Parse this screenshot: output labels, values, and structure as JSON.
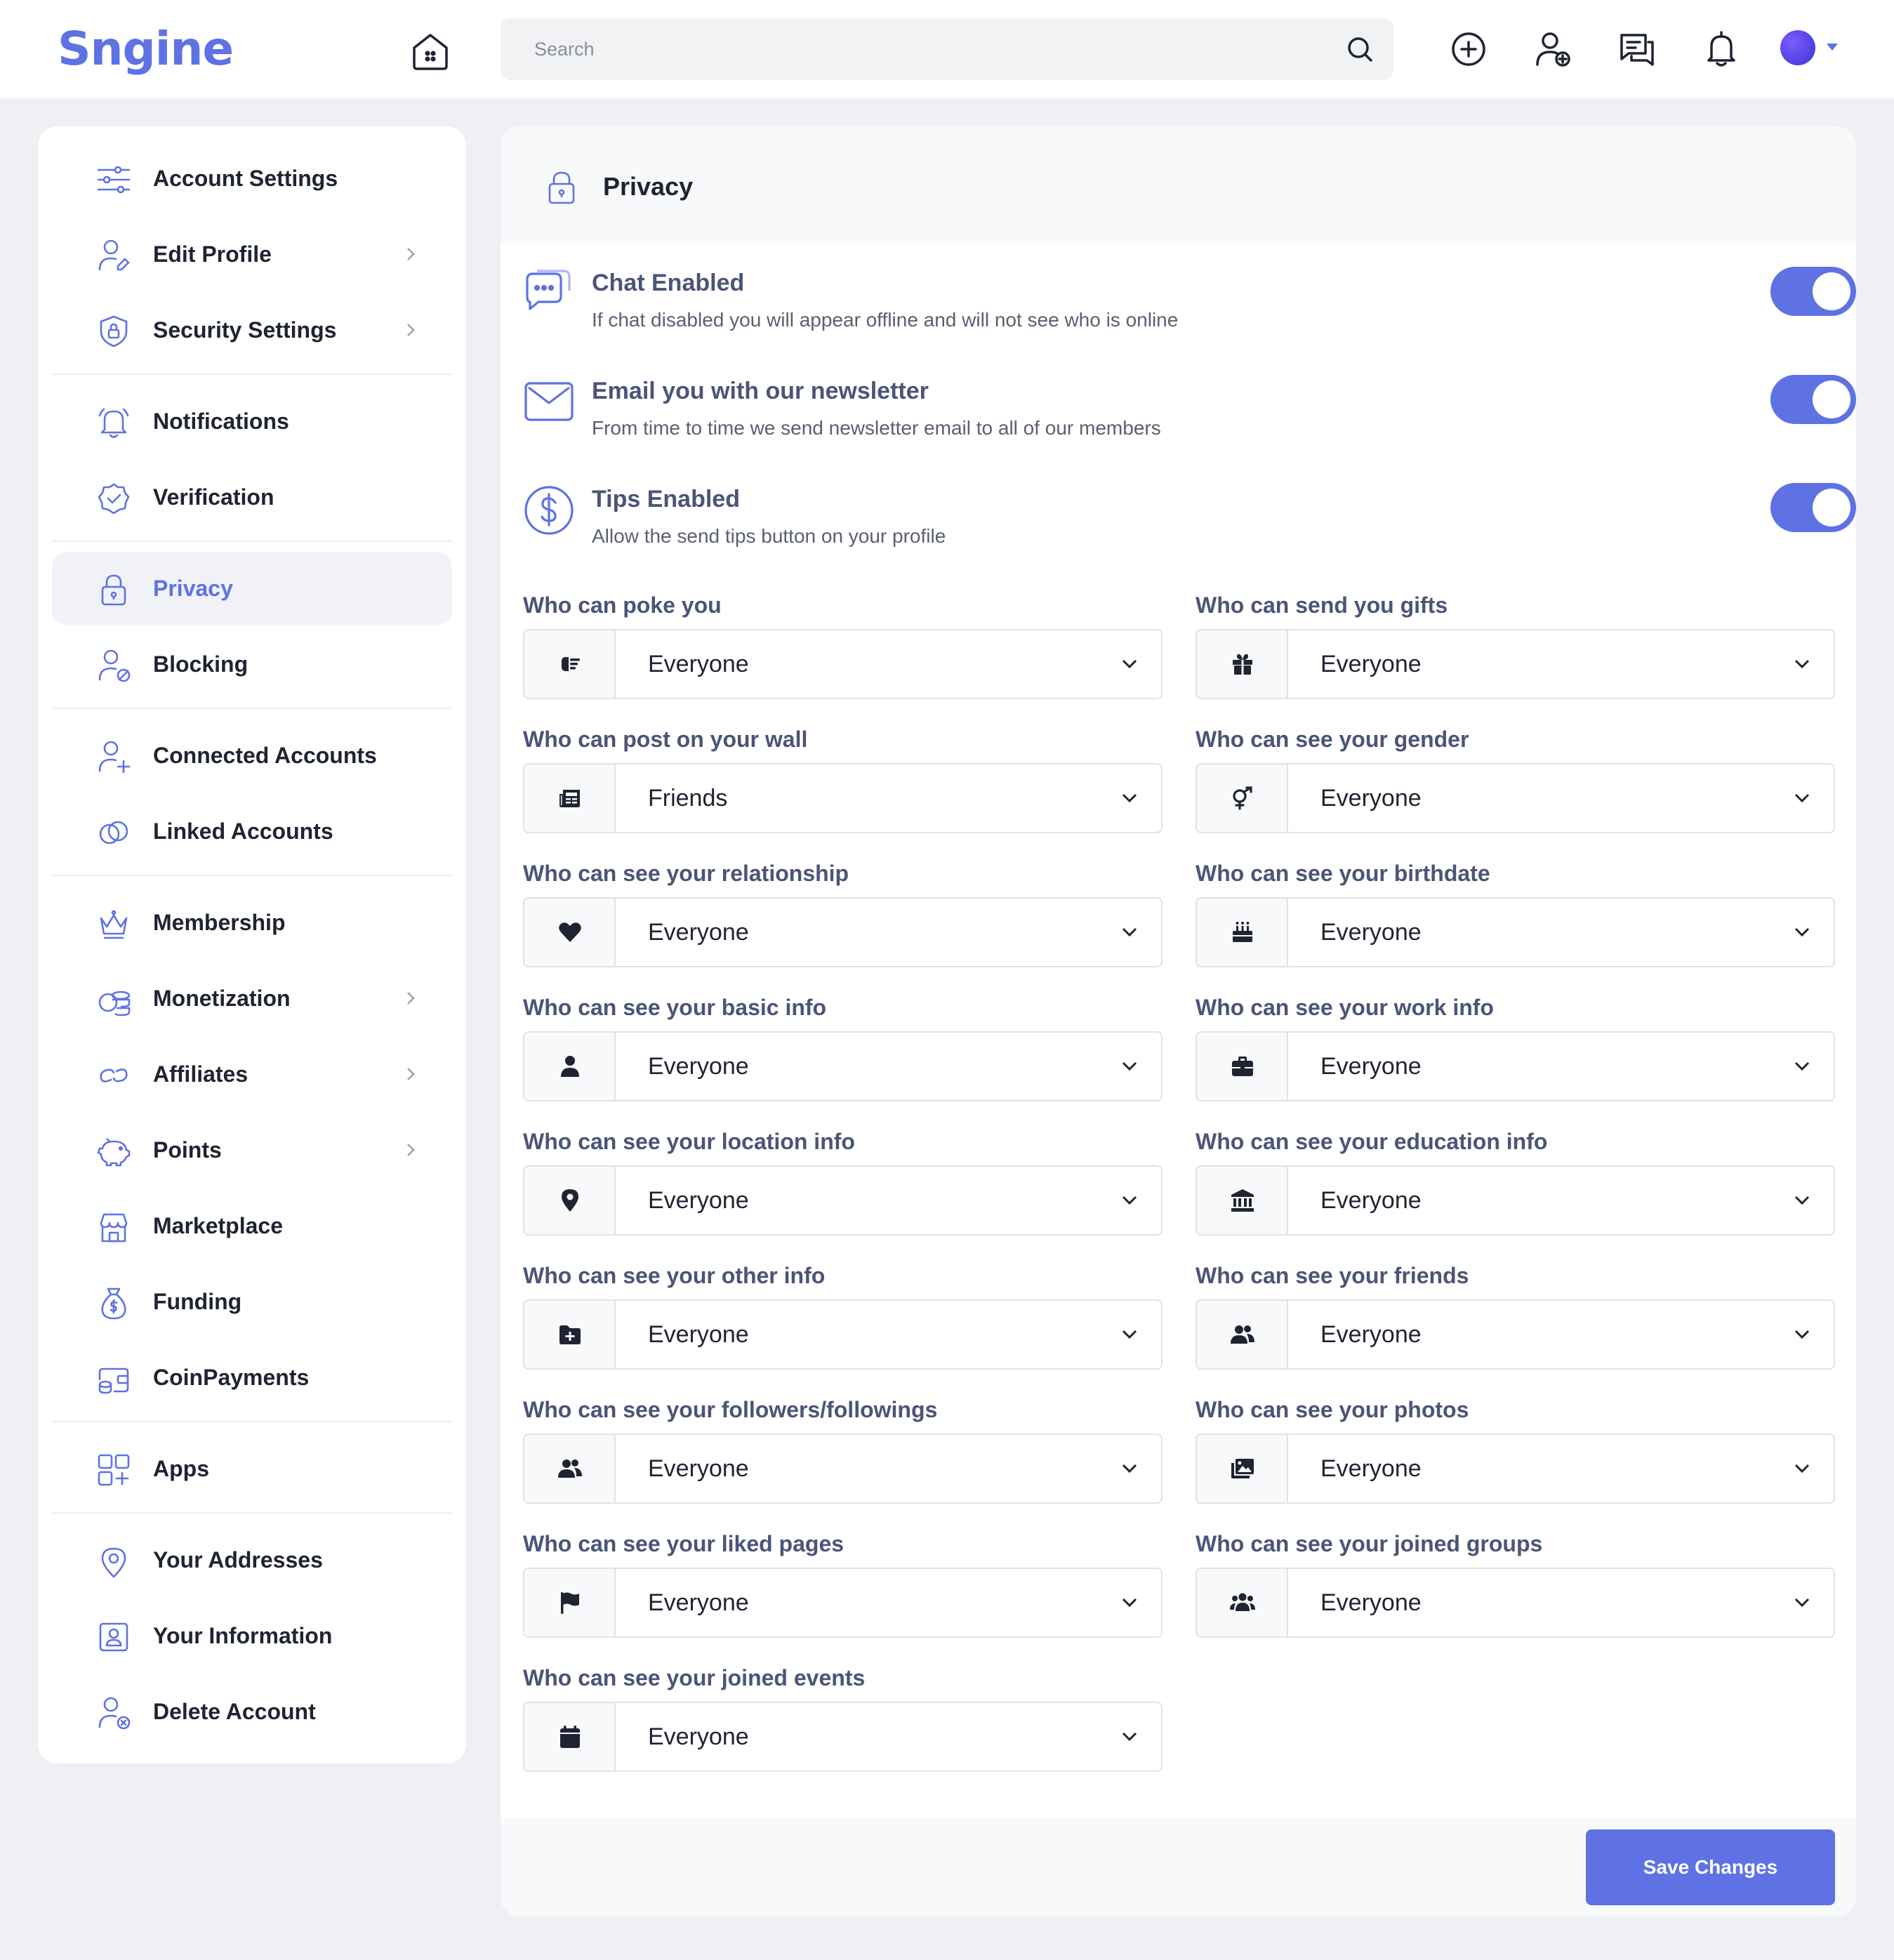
{
  "app": {
    "logo": "Sngine"
  },
  "search": {
    "placeholder": "Search"
  },
  "sidebar": {
    "items": [
      {
        "label": "Account Settings"
      },
      {
        "label": "Edit Profile"
      },
      {
        "label": "Security Settings"
      },
      {
        "label": "Notifications"
      },
      {
        "label": "Verification"
      },
      {
        "label": "Privacy"
      },
      {
        "label": "Blocking"
      },
      {
        "label": "Connected Accounts"
      },
      {
        "label": "Linked Accounts"
      },
      {
        "label": "Membership"
      },
      {
        "label": "Monetization"
      },
      {
        "label": "Affiliates"
      },
      {
        "label": "Points"
      },
      {
        "label": "Marketplace"
      },
      {
        "label": "Funding"
      },
      {
        "label": "CoinPayments"
      },
      {
        "label": "Apps"
      },
      {
        "label": "Your Addresses"
      },
      {
        "label": "Your Information"
      },
      {
        "label": "Delete Account"
      }
    ],
    "active": "Privacy"
  },
  "page": {
    "title": "Privacy",
    "toggles": [
      {
        "title": "Chat Enabled",
        "description": "If chat disabled you will appear offline and will not see who is online",
        "on": true
      },
      {
        "title": "Email you with our newsletter",
        "description": "From time to time we send newsletter email to all of our members",
        "on": true
      },
      {
        "title": "Tips Enabled",
        "description": "Allow the send tips button on your profile",
        "on": true
      }
    ],
    "fields": [
      {
        "label": "Who can poke you",
        "value": "Everyone",
        "icon": "poke-icon"
      },
      {
        "label": "Who can send you gifts",
        "value": "Everyone",
        "icon": "gift-icon"
      },
      {
        "label": "Who can post on your wall",
        "value": "Friends",
        "icon": "newspaper-icon"
      },
      {
        "label": "Who can see your gender",
        "value": "Everyone",
        "icon": "gender-icon"
      },
      {
        "label": "Who can see your relationship",
        "value": "Everyone",
        "icon": "heart-icon"
      },
      {
        "label": "Who can see your birthdate",
        "value": "Everyone",
        "icon": "birthday-cake-icon"
      },
      {
        "label": "Who can see your basic info",
        "value": "Everyone",
        "icon": "user-icon"
      },
      {
        "label": "Who can see your work info",
        "value": "Everyone",
        "icon": "briefcase-icon"
      },
      {
        "label": "Who can see your location info",
        "value": "Everyone",
        "icon": "map-pin-icon"
      },
      {
        "label": "Who can see your education info",
        "value": "Everyone",
        "icon": "university-icon"
      },
      {
        "label": "Who can see your other info",
        "value": "Everyone",
        "icon": "folder-plus-icon"
      },
      {
        "label": "Who can see your friends",
        "value": "Everyone",
        "icon": "users-icon"
      },
      {
        "label": "Who can see your followers/followings",
        "value": "Everyone",
        "icon": "followers-icon"
      },
      {
        "label": "Who can see your photos",
        "value": "Everyone",
        "icon": "photos-icon"
      },
      {
        "label": "Who can see your liked pages",
        "value": "Everyone",
        "icon": "flag-icon"
      },
      {
        "label": "Who can see your joined groups",
        "value": "Everyone",
        "icon": "groups-icon"
      },
      {
        "label": "Who can see your joined events",
        "value": "Everyone",
        "icon": "calendar-icon"
      }
    ],
    "save_label": "Save Changes"
  },
  "colors": {
    "accent": "#5e72e4",
    "label": "#4a5578",
    "page_bg": "#eef0f4"
  }
}
